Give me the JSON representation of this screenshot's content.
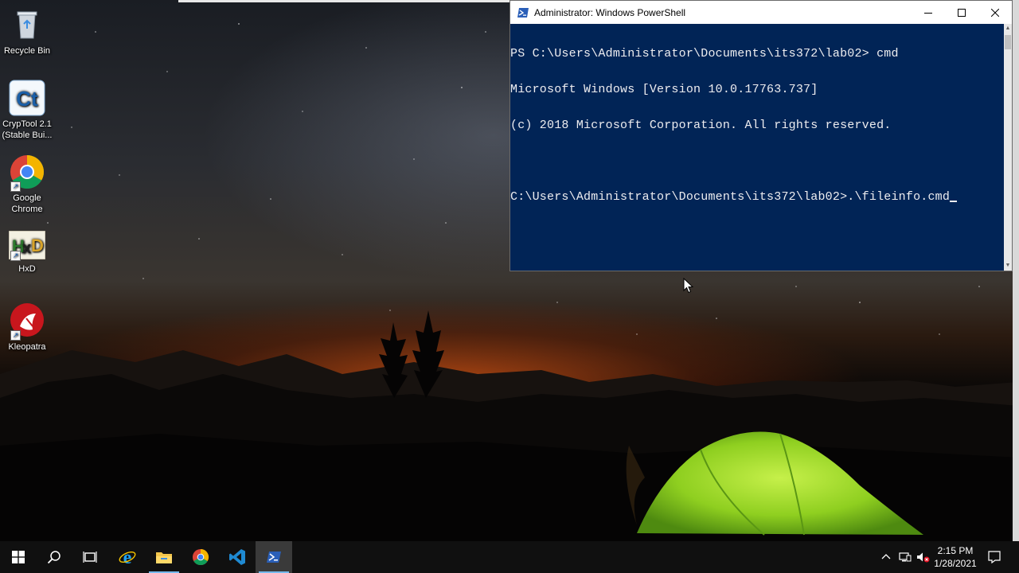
{
  "desktop": {
    "icons": [
      {
        "label_line1": "Recycle Bin",
        "label_line2": "",
        "icon": "recycle-bin-icon"
      },
      {
        "label_line1": "CrypTool 2.1",
        "label_line2": "(Stable Bui...",
        "icon": "cryptool-icon"
      },
      {
        "label_line1": "Google",
        "label_line2": "Chrome",
        "icon": "chrome-icon"
      },
      {
        "label_line1": "HxD",
        "label_line2": "",
        "icon": "hxd-icon"
      },
      {
        "label_line1": "Kleopatra",
        "label_line2": "",
        "icon": "kleopatra-icon"
      }
    ]
  },
  "powershell": {
    "title": "Administrator: Windows PowerShell",
    "lines": [
      "PS C:\\Users\\Administrator\\Documents\\its372\\lab02> cmd",
      "Microsoft Windows [Version 10.0.17763.737]",
      "(c) 2018 Microsoft Corporation. All rights reserved.",
      "",
      "C:\\Users\\Administrator\\Documents\\its372\\lab02>.\\fileinfo.cmd"
    ],
    "colors": {
      "background": "#012456",
      "text": "#eeedf0"
    }
  },
  "taskbar": {
    "items": [
      "start-icon",
      "search-icon",
      "task-view-icon",
      "internet-explorer-icon",
      "file-explorer-icon",
      "chrome-icon",
      "vscode-icon",
      "powershell-icon"
    ],
    "time": "2:15 PM",
    "date": "1/28/2021",
    "accent": "#76b9ed"
  }
}
